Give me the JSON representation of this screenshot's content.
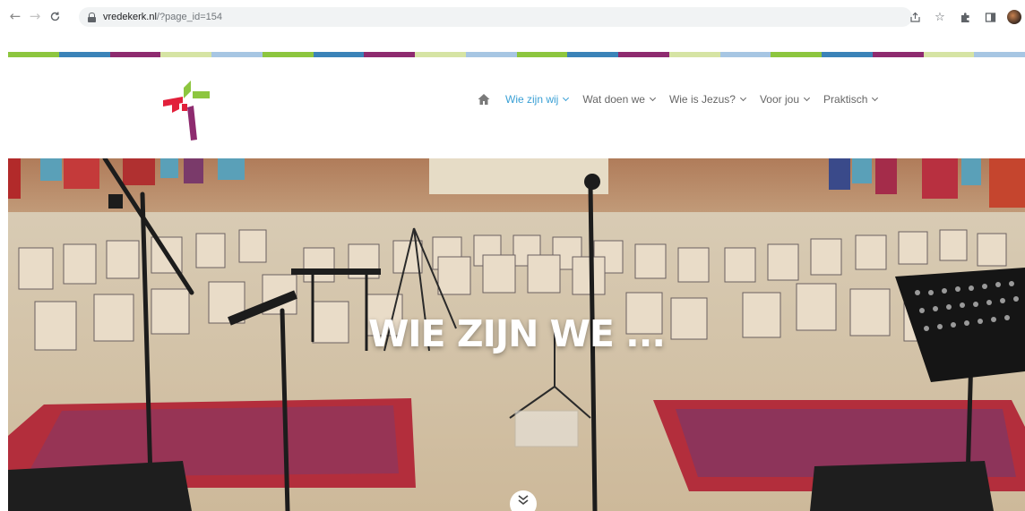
{
  "browser": {
    "back_icon": "arrow-left-icon",
    "forward_icon": "arrow-right-icon",
    "reload_icon": "reload-icon",
    "url_host": "vredekerk.nl",
    "url_path": "/?page_id=154",
    "right_icons": [
      "share-icon",
      "star-icon",
      "extensions-icon",
      "sidepanel-icon",
      "profile-avatar"
    ]
  },
  "stripe_colors": [
    "#8dc63f",
    "#3b83b8",
    "#8e2b6f",
    "#d6e4a4",
    "#a7c6e3",
    "#8dc63f",
    "#3b83b8",
    "#8e2b6f",
    "#d6e4a4",
    "#a7c6e3",
    "#8dc63f",
    "#3b83b8",
    "#8e2b6f",
    "#d6e4a4",
    "#a7c6e3",
    "#8dc63f",
    "#3b83b8",
    "#8e2b6f",
    "#d6e4a4",
    "#a7c6e3"
  ],
  "brand": {
    "logo_icon": "cross-logo-icon",
    "colors": {
      "green": "#8dc63f",
      "red": "#e2203b",
      "purple": "#8e2b6f",
      "accent": "#3aa0d5"
    }
  },
  "nav": {
    "home_icon": "home-icon",
    "items": [
      {
        "label": "Wie zijn wij",
        "active": true
      },
      {
        "label": "Wat doen we",
        "active": false
      },
      {
        "label": "Wie is Jezus?",
        "active": false
      },
      {
        "label": "Voor jou",
        "active": false
      },
      {
        "label": "Praktisch",
        "active": false
      }
    ]
  },
  "hero": {
    "title": "WIE ZIJN WE ...",
    "scroll_icon": "double-chevron-down-icon"
  }
}
